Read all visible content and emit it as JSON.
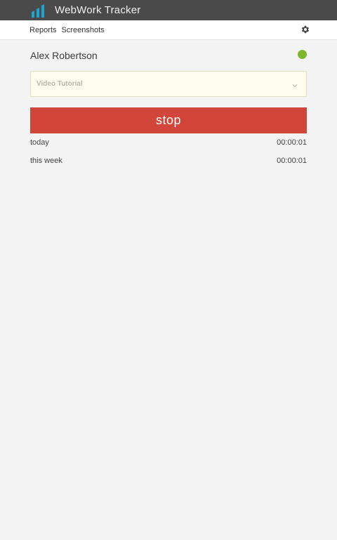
{
  "app": {
    "title": "WebWork Tracker",
    "logo_icon": "webwork-logo-icon",
    "accent": "#1fa4d6"
  },
  "menu": {
    "items": [
      "Reports",
      "Screenshots"
    ],
    "settings_icon": "gear-icon"
  },
  "user": {
    "name": "Alex Robertson",
    "status_color": "#7db72f"
  },
  "project": {
    "selected": "Video Tutorial",
    "icon": "chevron-down-icon"
  },
  "timer": {
    "button_label": "stop",
    "button_color": "#d2453a"
  },
  "stats": [
    {
      "label": "today",
      "value": "00:00:01"
    },
    {
      "label": "this week",
      "value": "00:00:01"
    }
  ]
}
